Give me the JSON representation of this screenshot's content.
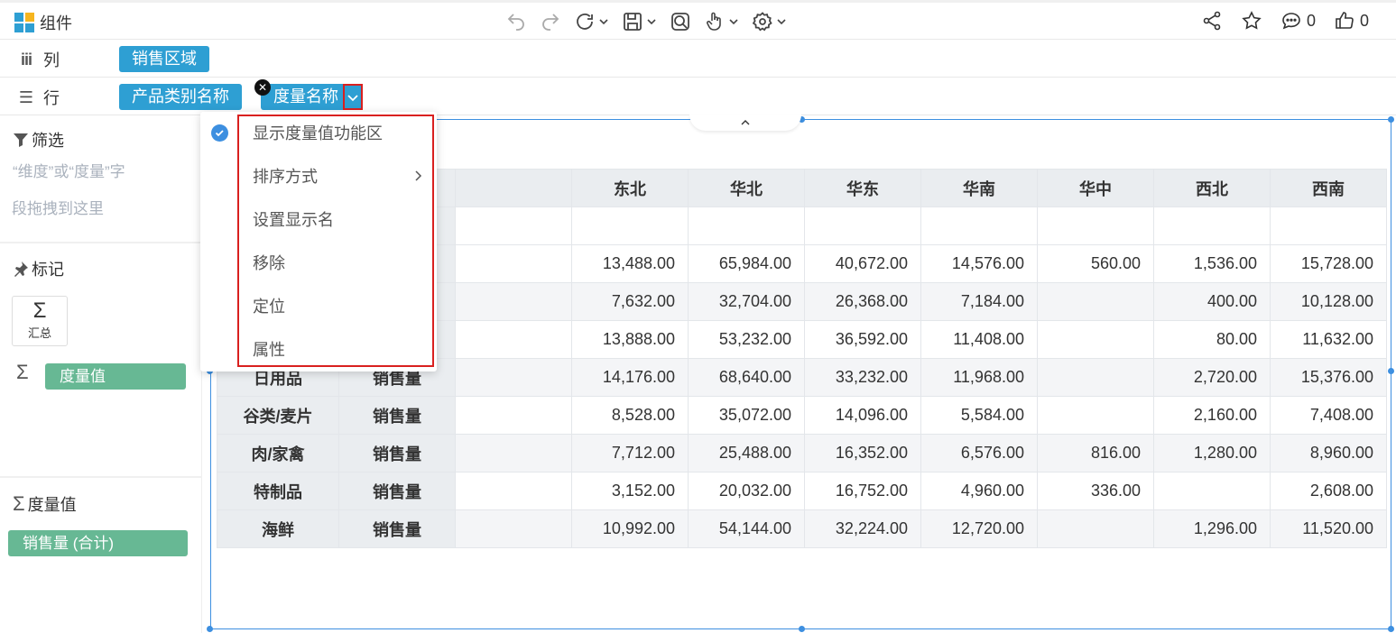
{
  "app": {
    "title": "组件"
  },
  "toolbar": {
    "icons": [
      "undo-icon",
      "redo-icon",
      "refresh-icon",
      "save-icon",
      "preview-icon",
      "interaction-icon",
      "settings-icon"
    ]
  },
  "right_tools": {
    "comment_count": "0",
    "like_count": "0"
  },
  "shelves": {
    "columns": {
      "label": "列",
      "pills": [
        "销售区域"
      ]
    },
    "rows": {
      "label": "行",
      "pills": [
        "产品类别名称",
        "度量名称"
      ]
    }
  },
  "left_panel": {
    "filter": {
      "title": "筛选",
      "hint_line1": "“维度”或“度量”字",
      "hint_line2": "段拖拽到这里"
    },
    "marks": {
      "title": "标记",
      "summary_label": "汇总",
      "pill": "度量值"
    },
    "measures": {
      "title": "度量值",
      "pill": "销售量 (合计)"
    }
  },
  "context_menu": {
    "items": [
      {
        "label": "显示度量值功能区",
        "checked": true
      },
      {
        "label": "排序方式",
        "submenu": true
      },
      {
        "label": "设置显示名"
      },
      {
        "label": "移除"
      },
      {
        "label": "定位"
      },
      {
        "label": "属性"
      }
    ]
  },
  "table": {
    "regions": [
      "东北",
      "华北",
      "华东",
      "华南",
      "华中",
      "西北",
      "西南"
    ],
    "rows": [
      {
        "category": "",
        "measure": "",
        "values": [
          "13,488.00",
          "65,984.00",
          "40,672.00",
          "14,576.00",
          "560.00",
          "1,536.00",
          "15,728.00"
        ]
      },
      {
        "category": "",
        "measure": "",
        "values": [
          "7,632.00",
          "32,704.00",
          "26,368.00",
          "7,184.00",
          "",
          "400.00",
          "10,128.00"
        ]
      },
      {
        "category": "",
        "measure": "",
        "values": [
          "13,888.00",
          "53,232.00",
          "36,592.00",
          "11,408.00",
          "",
          "80.00",
          "11,632.00"
        ]
      },
      {
        "category": "日用品",
        "measure": "销售量",
        "values": [
          "14,176.00",
          "68,640.00",
          "33,232.00",
          "11,968.00",
          "",
          "2,720.00",
          "15,376.00"
        ]
      },
      {
        "category": "谷类/麦片",
        "measure": "销售量",
        "values": [
          "8,528.00",
          "35,072.00",
          "14,096.00",
          "5,584.00",
          "",
          "2,160.00",
          "7,408.00"
        ]
      },
      {
        "category": "肉/家禽",
        "measure": "销售量",
        "values": [
          "7,712.00",
          "25,488.00",
          "16,352.00",
          "6,576.00",
          "816.00",
          "1,280.00",
          "8,960.00"
        ]
      },
      {
        "category": "特制品",
        "measure": "销售量",
        "values": [
          "3,152.00",
          "20,032.00",
          "16,752.00",
          "4,960.00",
          "336.00",
          "",
          "2,608.00"
        ]
      },
      {
        "category": "海鲜",
        "measure": "销售量",
        "values": [
          "10,992.00",
          "54,144.00",
          "32,224.00",
          "12,720.00",
          "",
          "1,296.00",
          "11,520.00"
        ]
      }
    ]
  },
  "colors": {
    "accent": "#2e9fd3",
    "highlight": "#d9201f",
    "green": "#67b894",
    "selection": "#3d8fe0"
  }
}
